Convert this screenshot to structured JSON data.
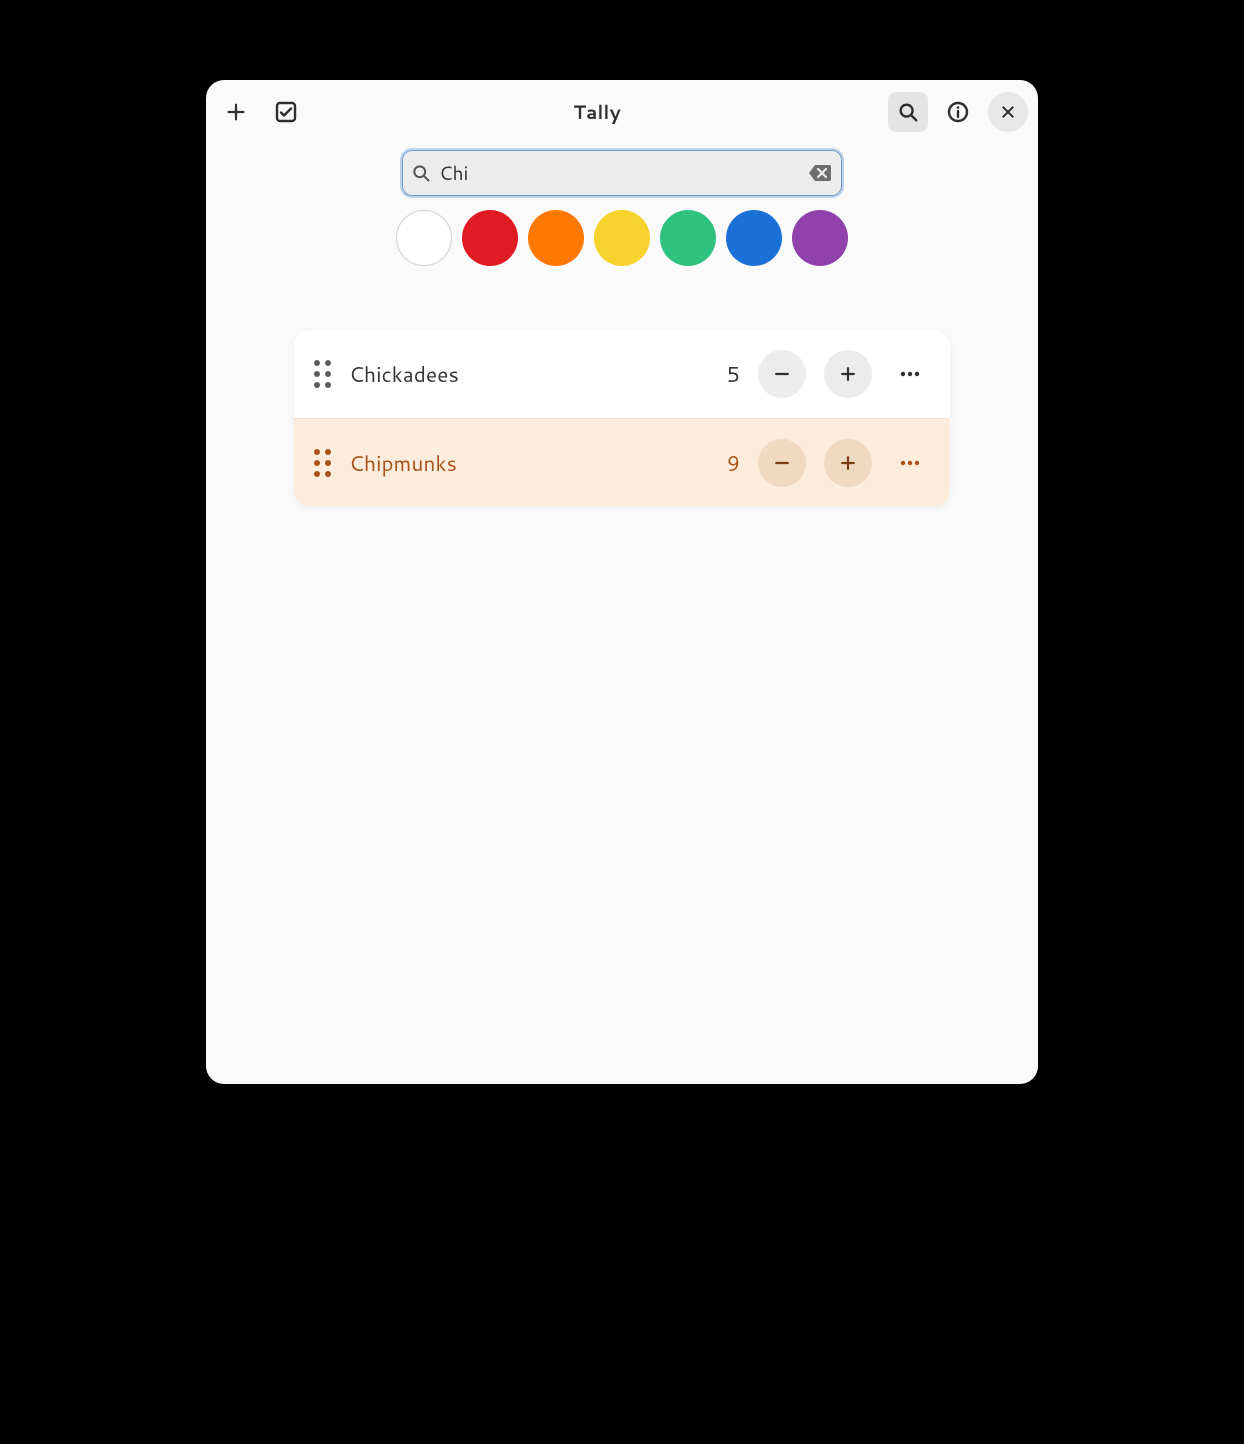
{
  "header": {
    "title": "Tally"
  },
  "search": {
    "value": "Chi",
    "active": true
  },
  "colors": [
    {
      "name": "white",
      "hex": "#ffffff"
    },
    {
      "name": "red",
      "hex": "#e01b24"
    },
    {
      "name": "orange",
      "hex": "#ff7800"
    },
    {
      "name": "yellow",
      "hex": "#f6d32d"
    },
    {
      "name": "green",
      "hex": "#2ec27e"
    },
    {
      "name": "blue",
      "hex": "#1c71d8"
    },
    {
      "name": "purple",
      "hex": "#9141ac"
    }
  ],
  "counters": [
    {
      "name": "Chickadees",
      "count": "5",
      "color": "default"
    },
    {
      "name": "Chipmunks",
      "count": "9",
      "color": "orange"
    }
  ]
}
